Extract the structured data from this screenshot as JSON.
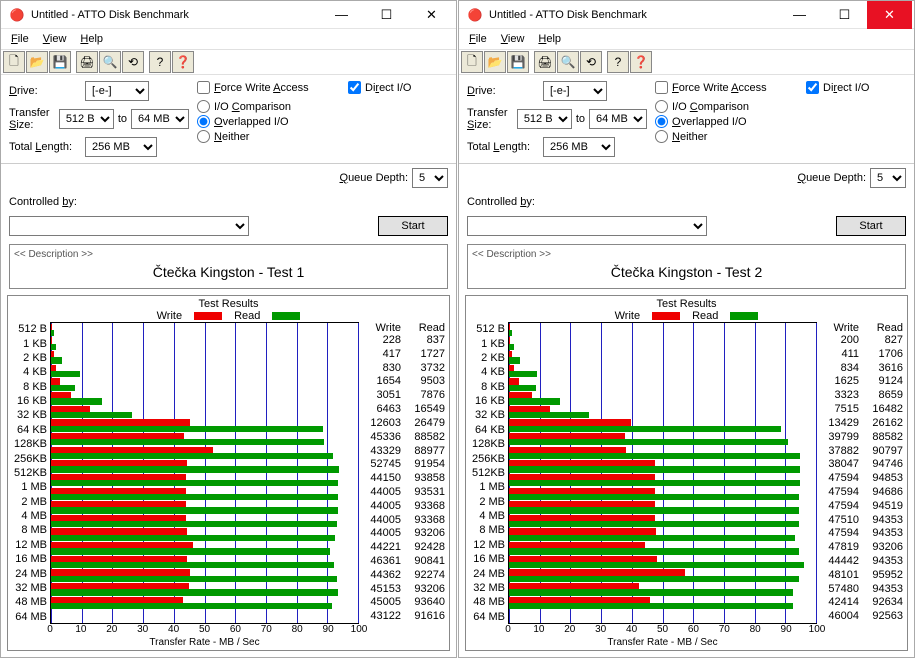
{
  "windows": [
    {
      "title": "Untitled - ATTO Disk Benchmark",
      "close_red": false,
      "menu": [
        "File",
        "View",
        "Help"
      ],
      "config": {
        "drive_label": "Drive:",
        "drive": "[-e-]",
        "ts_label": "Transfer Size:",
        "ts_from": "512 B",
        "ts_to": "64 MB",
        "ts_to_word": "to",
        "tl_label": "Total Length:",
        "tl": "256 MB",
        "fwa": "Force Write Access",
        "fwa_on": false,
        "dio": "Direct I/O",
        "dio_on": true,
        "r1": "I/O Comparison",
        "r2": "Overlapped I/O",
        "r3": "Neither",
        "r_sel": 2,
        "qd_label": "Queue Depth:",
        "qd": "5"
      },
      "controlled_by": "Controlled by:",
      "start": "Start",
      "desc_hdr": "<< Description >>",
      "desc": "Čtečka Kingston - Test 1",
      "results_title": "Test Results",
      "legend_write": "Write",
      "legend_read": "Read",
      "xlabel": "Transfer Rate - MB / Sec",
      "chart_data": {
        "type": "bar",
        "xlabel": "Transfer Rate - MB / Sec",
        "xlim": [
          0,
          100
        ],
        "xticks": [
          0,
          10,
          20,
          30,
          40,
          50,
          60,
          70,
          80,
          90,
          100
        ],
        "categories": [
          "512 B",
          "1 KB",
          "2 KB",
          "4 KB",
          "8 KB",
          "16 KB",
          "32 KB",
          "64 KB",
          "128KB",
          "256KB",
          "512KB",
          "1 MB",
          "2 MB",
          "4 MB",
          "8 MB",
          "12 MB",
          "16 MB",
          "24 MB",
          "32 MB",
          "48 MB",
          "64 MB"
        ],
        "series": [
          {
            "name": "Write",
            "color": "#e00",
            "values": [
              228,
              417,
              830,
              1654,
              3051,
              6463,
              12603,
              45336,
              43329,
              52745,
              44150,
              44005,
              44005,
              44005,
              44005,
              44221,
              46361,
              44362,
              45153,
              45005,
              43122
            ]
          },
          {
            "name": "Read",
            "color": "#090",
            "values": [
              837,
              1727,
              3732,
              9503,
              7876,
              16549,
              26479,
              88582,
              88977,
              91954,
              93858,
              93531,
              93368,
              93368,
              93206,
              92428,
              90841,
              92274,
              93206,
              93640,
              91616
            ]
          }
        ]
      }
    },
    {
      "title": "Untitled - ATTO Disk Benchmark",
      "close_red": true,
      "menu": [
        "File",
        "View",
        "Help"
      ],
      "config": {
        "drive_label": "Drive:",
        "drive": "[-e-]",
        "ts_label": "Transfer Size:",
        "ts_from": "512 B",
        "ts_to": "64 MB",
        "ts_to_word": "to",
        "tl_label": "Total Length:",
        "tl": "256 MB",
        "fwa": "Force Write Access",
        "fwa_on": false,
        "dio": "Direct I/O",
        "dio_on": true,
        "r1": "I/O Comparison",
        "r2": "Overlapped I/O",
        "r3": "Neither",
        "r_sel": 2,
        "qd_label": "Queue Depth:",
        "qd": "5"
      },
      "controlled_by": "Controlled by:",
      "start": "Start",
      "desc_hdr": "<< Description >>",
      "desc": "Čtečka Kingston - Test 2",
      "results_title": "Test Results",
      "legend_write": "Write",
      "legend_read": "Read",
      "xlabel": "Transfer Rate - MB / Sec",
      "chart_data": {
        "type": "bar",
        "xlabel": "Transfer Rate - MB / Sec",
        "xlim": [
          0,
          100
        ],
        "xticks": [
          0,
          10,
          20,
          30,
          40,
          50,
          60,
          70,
          80,
          90,
          100
        ],
        "categories": [
          "512 B",
          "1 KB",
          "2 KB",
          "4 KB",
          "8 KB",
          "16 KB",
          "32 KB",
          "64 KB",
          "128KB",
          "256KB",
          "512KB",
          "1 MB",
          "2 MB",
          "4 MB",
          "8 MB",
          "12 MB",
          "16 MB",
          "24 MB",
          "32 MB",
          "48 MB",
          "64 MB"
        ],
        "series": [
          {
            "name": "Write",
            "color": "#e00",
            "values": [
              200,
              411,
              834,
              1625,
              3323,
              7515,
              13429,
              39799,
              37882,
              38047,
              47594,
              47594,
              47594,
              47510,
              47594,
              47819,
              44442,
              48101,
              57480,
              42414,
              46004
            ]
          },
          {
            "name": "Read",
            "color": "#090",
            "values": [
              827,
              1706,
              3616,
              9124,
              8659,
              16482,
              26162,
              88582,
              90797,
              94746,
              94853,
              94686,
              94519,
              94353,
              94353,
              93206,
              94353,
              95952,
              94353,
              92634,
              92563
            ]
          }
        ]
      }
    }
  ],
  "icons": {
    "new": "🗋",
    "open": "📂",
    "save": "💾",
    "print": "🖨",
    "zoom": "🔍",
    "reset": "⟲",
    "help": "?",
    "whats": "❓"
  }
}
